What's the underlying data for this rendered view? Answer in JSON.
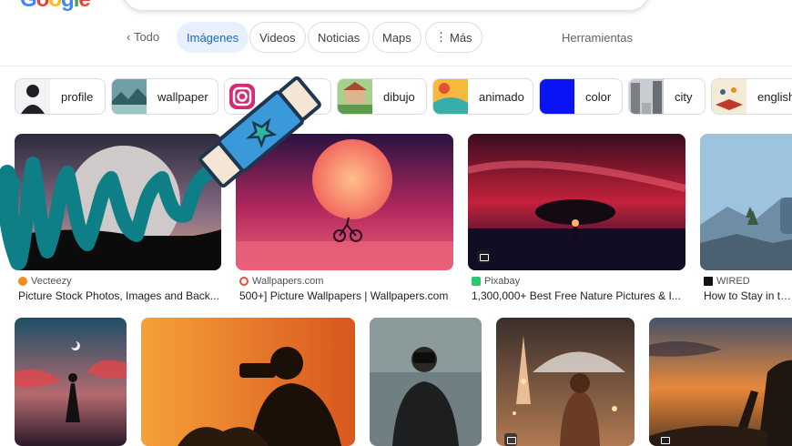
{
  "logo": {
    "text": "Google"
  },
  "tabs": {
    "back_label": "Todo",
    "items": [
      {
        "label": "Imágenes",
        "active": true
      },
      {
        "label": "Videos"
      },
      {
        "label": "Noticias"
      },
      {
        "label": "Maps"
      },
      {
        "label": "Más"
      }
    ],
    "tools_label": "Herramientas"
  },
  "filters": [
    {
      "label": "profile"
    },
    {
      "label": "wallpaper"
    },
    {
      "label": ""
    },
    {
      "label": "dibujo"
    },
    {
      "label": "animado"
    },
    {
      "label": "color"
    },
    {
      "label": "city"
    },
    {
      "label": "english"
    }
  ],
  "results_row1": [
    {
      "source": "Vecteezy",
      "title": "Picture Stock Photos, Images and Back..."
    },
    {
      "source": "Wallpapers.com",
      "title": "500+] Picture Wallpapers | Wallpapers.com"
    },
    {
      "source": "Pixabay",
      "title": "1,300,000+ Best Free Nature Pictures & I..."
    },
    {
      "source": "WIRED",
      "title": "How to Stay in the"
    }
  ],
  "colors": {
    "accent": "#1967d2",
    "active_tab_bg": "#e8f0fe",
    "scribble": "#0e7f86",
    "eraser_blue": "#3a9ad9"
  }
}
